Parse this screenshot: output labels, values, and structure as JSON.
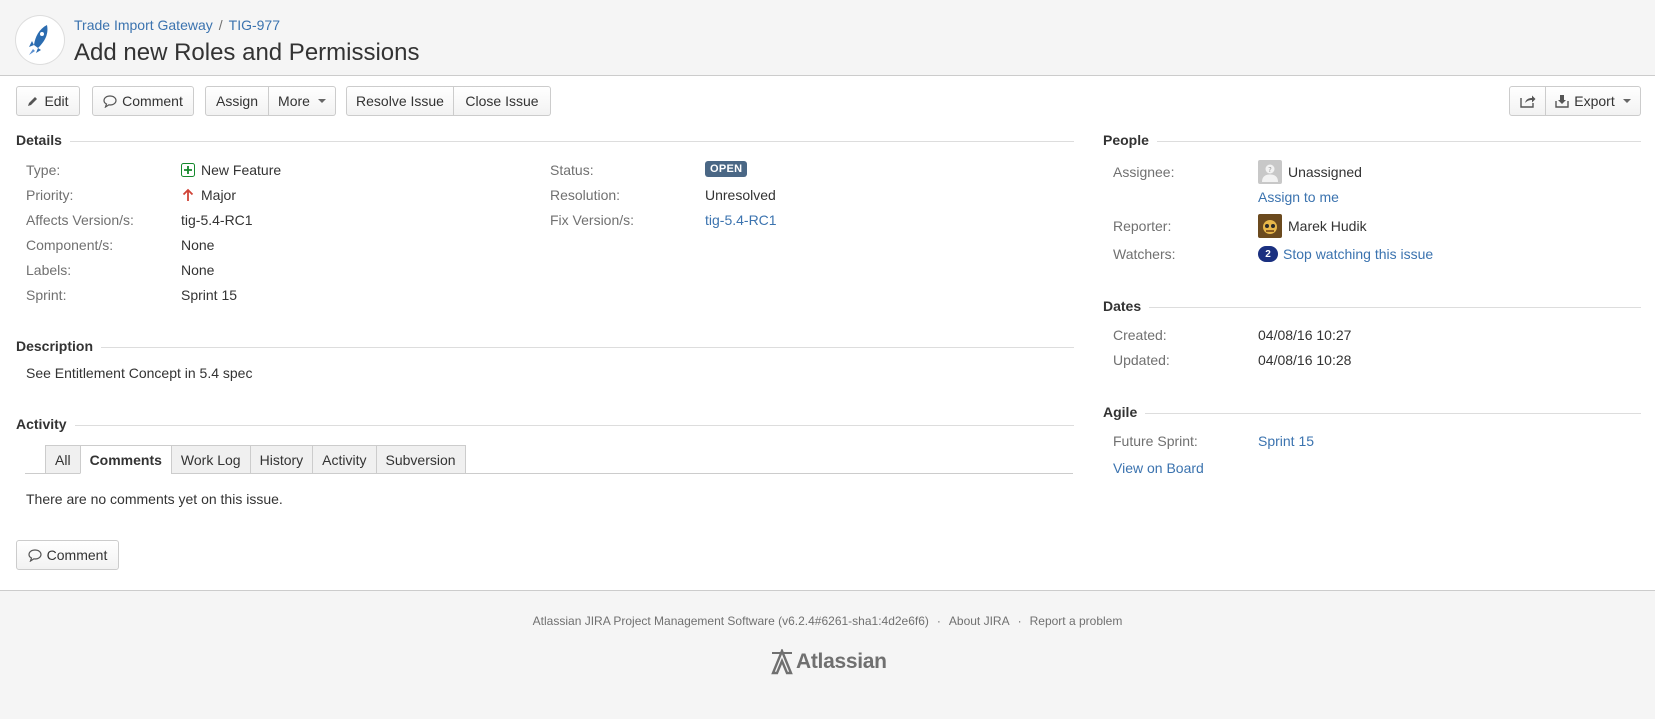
{
  "header": {
    "breadcrumb_project": "Trade Import Gateway",
    "breadcrumb_separator": "/",
    "breadcrumb_issue": "TIG-977",
    "title": "Add new Roles and Permissions"
  },
  "toolbar": {
    "edit": "Edit",
    "comment": "Comment",
    "assign": "Assign",
    "more": "More",
    "resolve": "Resolve Issue",
    "close": "Close Issue",
    "export": "Export"
  },
  "details": {
    "heading": "Details",
    "type_label": "Type:",
    "type_value": "New Feature",
    "priority_label": "Priority:",
    "priority_value": "Major",
    "affects_label": "Affects Version/s:",
    "affects_value": "tig-5.4-RC1",
    "components_label": "Component/s:",
    "components_value": "None",
    "labels_label": "Labels:",
    "labels_value": "None",
    "sprint_label": "Sprint:",
    "sprint_value": "Sprint 15",
    "status_label": "Status:",
    "status_value": "OPEN",
    "resolution_label": "Resolution:",
    "resolution_value": "Unresolved",
    "fix_label": "Fix Version/s:",
    "fix_value": "tig-5.4-RC1"
  },
  "description": {
    "heading": "Description",
    "text": "See Entitlement Concept in 5.4 spec"
  },
  "activity": {
    "heading": "Activity",
    "tabs": [
      "All",
      "Comments",
      "Work Log",
      "History",
      "Activity",
      "Subversion"
    ],
    "active_tab": "Comments",
    "empty_text": "There are no comments yet on this issue.",
    "comment_button": "Comment"
  },
  "people": {
    "heading": "People",
    "assignee_label": "Assignee:",
    "assignee_value": "Unassigned",
    "assign_to_me": "Assign to me",
    "reporter_label": "Reporter:",
    "reporter_value": "Marek Hudik",
    "watchers_label": "Watchers:",
    "watchers_count": "2",
    "watch_link": "Stop watching this issue"
  },
  "dates": {
    "heading": "Dates",
    "created_label": "Created:",
    "created_value": "04/08/16 10:27",
    "updated_label": "Updated:",
    "updated_value": "04/08/16 10:28"
  },
  "agile": {
    "heading": "Agile",
    "future_sprint_label": "Future Sprint:",
    "future_sprint_value": "Sprint 15",
    "view_on_board": "View on Board"
  },
  "footer": {
    "software": "Atlassian JIRA Project Management Software (v6.2.4#6261-sha1:4d2e6f6)",
    "dot": "·",
    "about": "About JIRA",
    "report": "Report a problem",
    "logo_text": "Atlassian"
  },
  "colors": {
    "link": "#3b73af",
    "status_open": "#4a6785",
    "watch_badge": "#1a3080",
    "priority_major": "#d04437",
    "new_feature": "#14892c"
  }
}
